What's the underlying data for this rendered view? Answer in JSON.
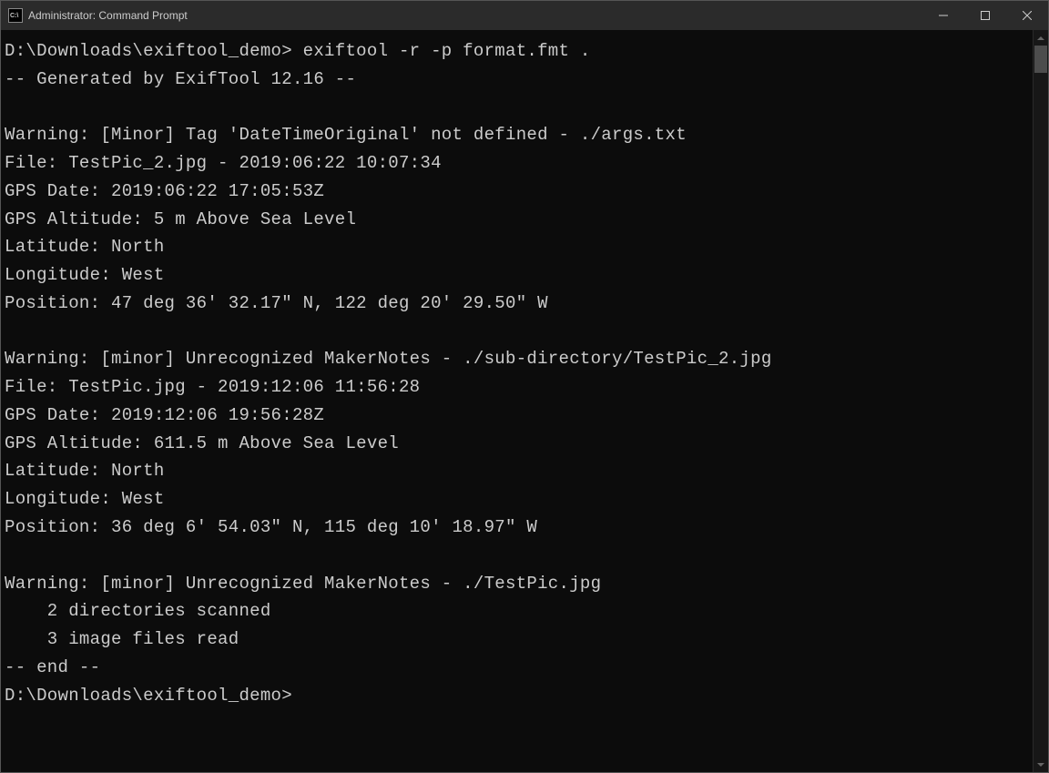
{
  "titlebar": {
    "title": "Administrator: Command Prompt"
  },
  "terminal": {
    "lines": [
      "D:\\Downloads\\exiftool_demo> exiftool -r -p format.fmt .",
      "-- Generated by ExifTool 12.16 --",
      "",
      "Warning: [Minor] Tag 'DateTimeOriginal' not defined - ./args.txt",
      "File: TestPic_2.jpg - 2019:06:22 10:07:34",
      "GPS Date: 2019:06:22 17:05:53Z",
      "GPS Altitude: 5 m Above Sea Level",
      "Latitude: North",
      "Longitude: West",
      "Position: 47 deg 36' 32.17\" N, 122 deg 20' 29.50\" W",
      "",
      "Warning: [minor] Unrecognized MakerNotes - ./sub-directory/TestPic_2.jpg",
      "File: TestPic.jpg - 2019:12:06 11:56:28",
      "GPS Date: 2019:12:06 19:56:28Z",
      "GPS Altitude: 611.5 m Above Sea Level",
      "Latitude: North",
      "Longitude: West",
      "Position: 36 deg 6' 54.03\" N, 115 deg 10' 18.97\" W",
      "",
      "Warning: [minor] Unrecognized MakerNotes - ./TestPic.jpg",
      "    2 directories scanned",
      "    3 image files read",
      "-- end --",
      "D:\\Downloads\\exiftool_demo>"
    ]
  }
}
